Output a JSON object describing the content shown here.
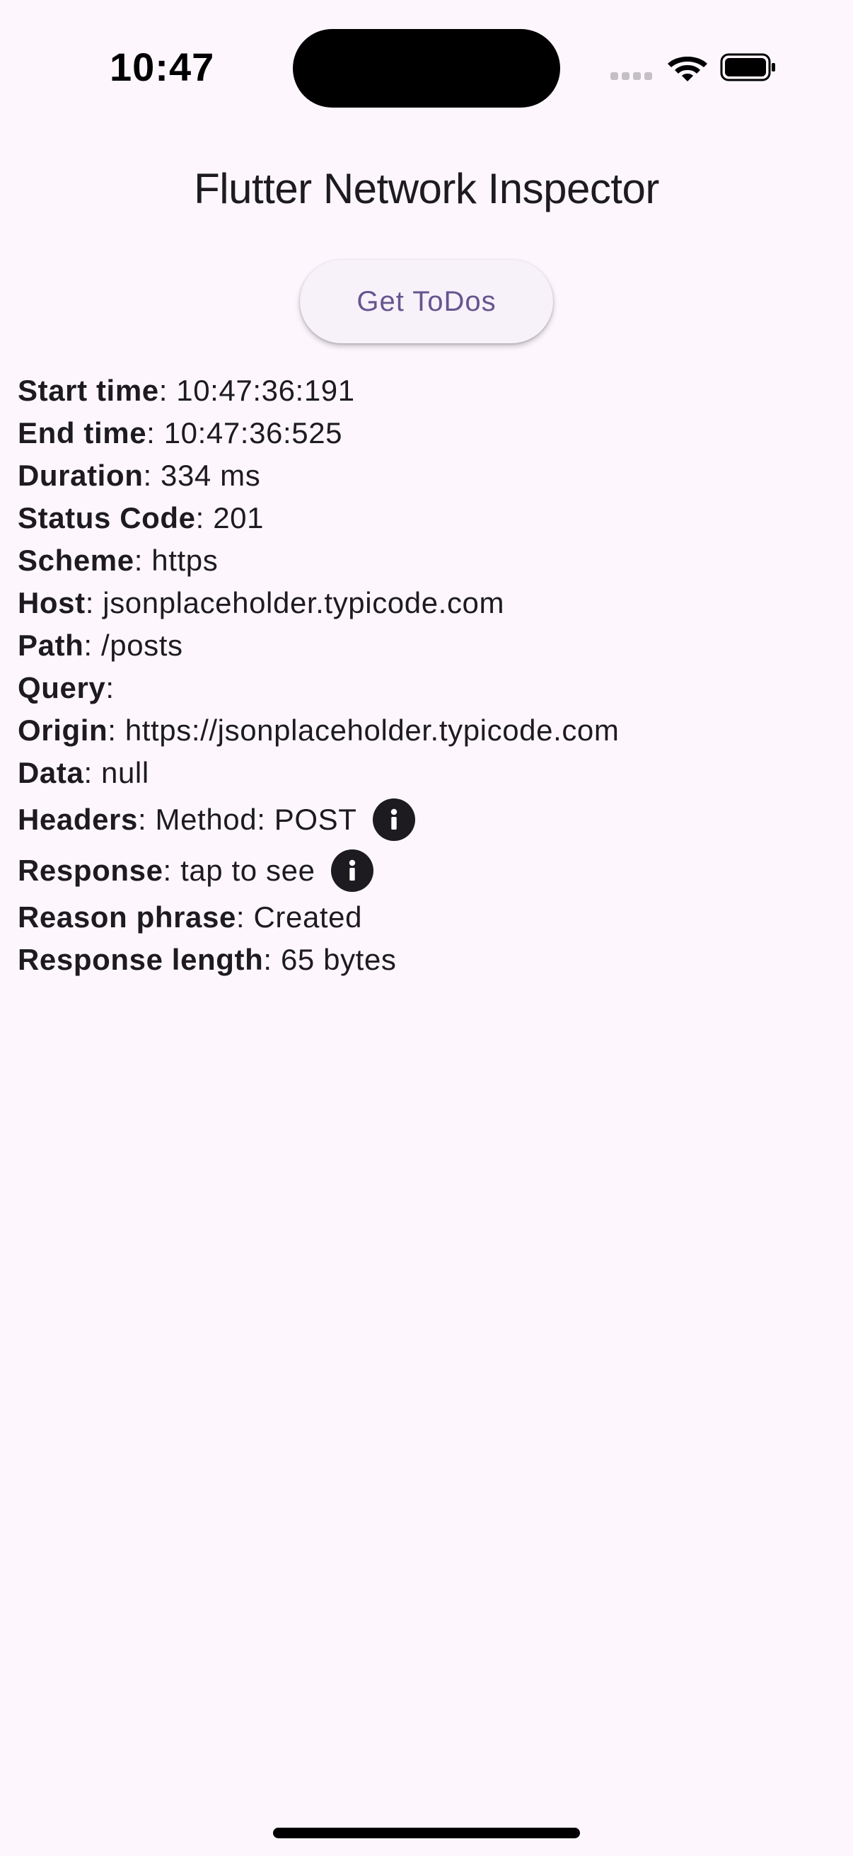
{
  "status_bar": {
    "time": "10:47"
  },
  "app": {
    "title": "Flutter Network Inspector",
    "button_label": "Get ToDos"
  },
  "details": [
    {
      "key": "Start time",
      "value": "10:47:36:191",
      "info_icon": false
    },
    {
      "key": "End time",
      "value": "10:47:36:525",
      "info_icon": false
    },
    {
      "key": "Duration",
      "value": "334 ms",
      "info_icon": false
    },
    {
      "key": "Status Code",
      "value": "201",
      "info_icon": false
    },
    {
      "key": "Scheme",
      "value": "https",
      "info_icon": false
    },
    {
      "key": "Host",
      "value": "jsonplaceholder.typicode.com",
      "info_icon": false
    },
    {
      "key": "Path",
      "value": "/posts",
      "info_icon": false
    },
    {
      "key": "Query",
      "value": "",
      "info_icon": false
    },
    {
      "key": "Origin",
      "value": "https://jsonplaceholder.typicode.com",
      "info_icon": false
    },
    {
      "key": "Data",
      "value": "null",
      "info_icon": false
    },
    {
      "key": "Headers",
      "value": "Method: POST",
      "info_icon": true
    },
    {
      "key": "Response",
      "value": "tap to see",
      "info_icon": true
    },
    {
      "key": "Reason phrase",
      "value": "Created",
      "info_icon": false
    },
    {
      "key": "Response length",
      "value": "65 bytes",
      "info_icon": false
    }
  ],
  "icons": {
    "info": "info-icon",
    "wifi": "wifi-icon",
    "battery": "battery-icon",
    "signal": "cellular-signal-icon"
  }
}
